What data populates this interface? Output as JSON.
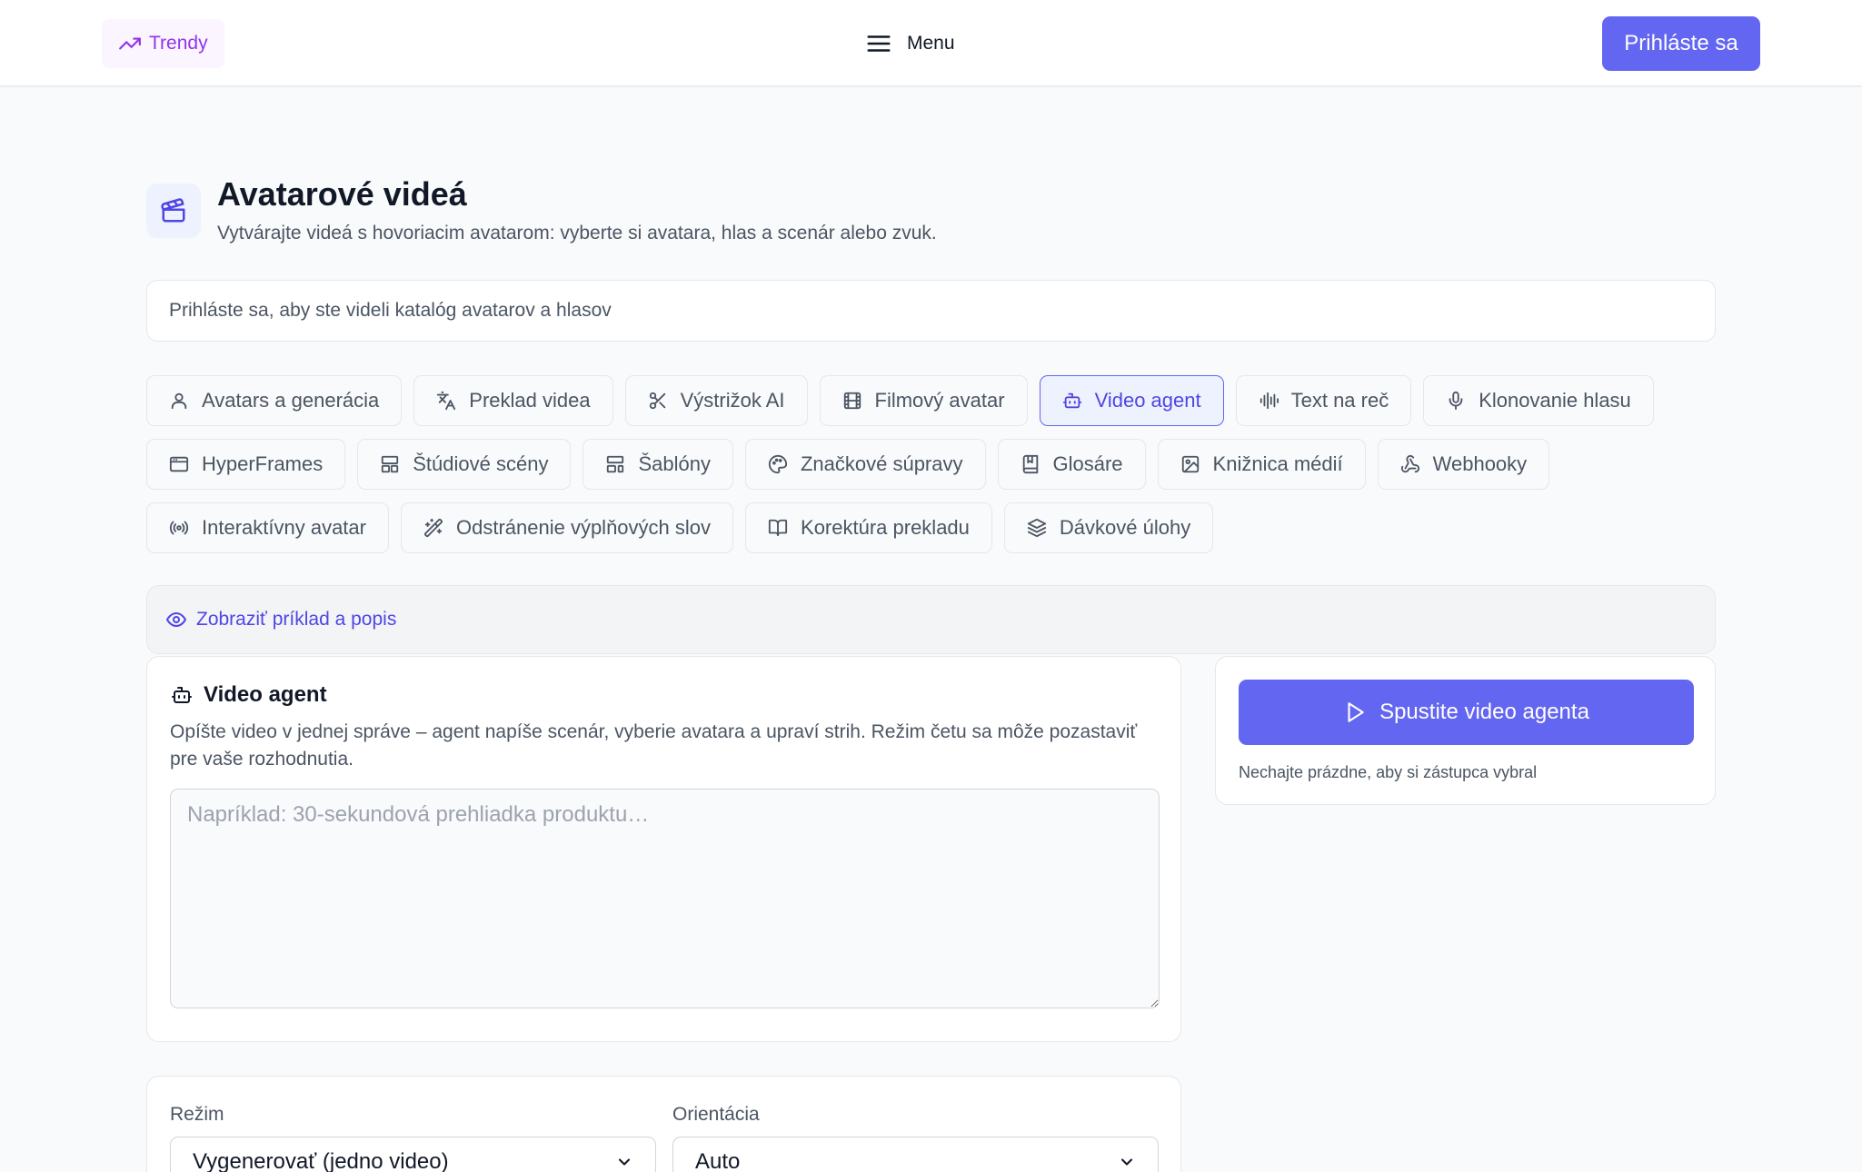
{
  "header": {
    "trendy_label": "Trendy",
    "menu_label": "Menu",
    "login_label": "Prihláste sa"
  },
  "page": {
    "title": "Avatarové videá",
    "subtitle": "Vytvárajte videá s hovoriacim avatarom: vyberte si avatara, hlas a scenár alebo zvuk.",
    "notice": "Prihláste sa, aby ste videli katalóg avatarov a hlasov"
  },
  "tabs": [
    {
      "label": "Avatars a generácia",
      "icon": "user-icon"
    },
    {
      "label": "Preklad videa",
      "icon": "translate-icon"
    },
    {
      "label": "Výstrižok AI",
      "icon": "scissors-icon"
    },
    {
      "label": "Filmový avatar",
      "icon": "film-icon"
    },
    {
      "label": "Video agent",
      "icon": "bot-icon",
      "active": true
    },
    {
      "label": "Text na reč",
      "icon": "waveform-icon"
    },
    {
      "label": "Klonovanie hlasu",
      "icon": "microphone-icon"
    },
    {
      "label": "HyperFrames",
      "icon": "browser-icon"
    },
    {
      "label": "Štúdiové scény",
      "icon": "layout-icon"
    },
    {
      "label": "Šablóny",
      "icon": "template-icon"
    },
    {
      "label": "Značkové súpravy",
      "icon": "palette-icon"
    },
    {
      "label": "Glosáre",
      "icon": "book-icon"
    },
    {
      "label": "Knižnica médií",
      "icon": "image-icon"
    },
    {
      "label": "Webhooky",
      "icon": "webhook-icon"
    },
    {
      "label": "Interaktívny avatar",
      "icon": "broadcast-icon"
    },
    {
      "label": "Odstránenie výplňových slov",
      "icon": "magic-wand-icon"
    },
    {
      "label": "Korektúra prekladu",
      "icon": "open-book-icon"
    },
    {
      "label": "Dávkové úlohy",
      "icon": "layers-icon"
    }
  ],
  "example_toggle": "Zobraziť príklad a popis",
  "agent": {
    "title": "Video agent",
    "description": "Opíšte video v jednej správe – agent napíše scenár, vyberie avatara a upraví strih. Režim četu sa môže pozastaviť pre vaše rozhodnutia.",
    "placeholder": "Napríklad: 30-sekundová prehliadka produktu…",
    "value": ""
  },
  "run": {
    "button_label": "Spustite video agenta",
    "hint": "Nechajte prázdne, aby si zástupca vybral"
  },
  "settings": {
    "mode_label": "Režim",
    "mode_value": "Vygenerovať (jedno video)",
    "orientation_label": "Orientácia",
    "orientation_value": "Auto"
  },
  "colors": {
    "accent": "#6366f1",
    "accent_text": "#4f46e5",
    "trendy": "#9333ea",
    "background": "#f9fafb"
  }
}
